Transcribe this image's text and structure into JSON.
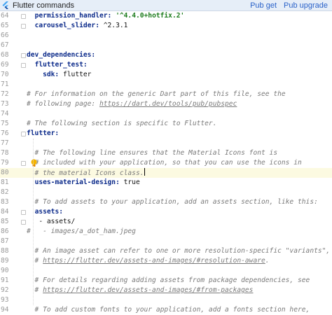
{
  "header": {
    "title": "Flutter commands",
    "actions": [
      "Pub get",
      "Pub upgrade"
    ]
  },
  "lines": [
    {
      "num": "64",
      "parts": [
        {
          "t": "  ",
          "c": "plain"
        },
        {
          "t": "permission_handler:",
          "c": "key"
        },
        {
          "t": " ",
          "c": "plain"
        },
        {
          "t": "'^4.4.0+hotfix.2'",
          "c": "str"
        }
      ]
    },
    {
      "num": "65",
      "parts": [
        {
          "t": "  ",
          "c": "plain"
        },
        {
          "t": "carousel_slider:",
          "c": "key"
        },
        {
          "t": " ^2.3.1",
          "c": "plain"
        }
      ]
    },
    {
      "num": "66",
      "parts": []
    },
    {
      "num": "67",
      "parts": []
    },
    {
      "num": "68",
      "parts": [
        {
          "t": "dev_dependencies:",
          "c": "key"
        }
      ]
    },
    {
      "num": "69",
      "parts": [
        {
          "t": "  ",
          "c": "plain"
        },
        {
          "t": "flutter_test:",
          "c": "key"
        }
      ]
    },
    {
      "num": "70",
      "parts": [
        {
          "t": "    ",
          "c": "plain"
        },
        {
          "t": "sdk:",
          "c": "key"
        },
        {
          "t": " flutter",
          "c": "plain"
        }
      ]
    },
    {
      "num": "71",
      "parts": []
    },
    {
      "num": "72",
      "parts": [
        {
          "t": "# For information on the generic Dart part of this file, see the",
          "c": "cmt"
        }
      ]
    },
    {
      "num": "73",
      "parts": [
        {
          "t": "# following page: ",
          "c": "cmt"
        },
        {
          "t": "https://dart.dev/tools/pub/pubspec",
          "c": "url"
        }
      ]
    },
    {
      "num": "74",
      "parts": []
    },
    {
      "num": "75",
      "parts": [
        {
          "t": "# The following section is specific to Flutter.",
          "c": "cmt"
        }
      ]
    },
    {
      "num": "76",
      "parts": [
        {
          "t": "flutter:",
          "c": "key"
        }
      ]
    },
    {
      "num": "77",
      "parts": []
    },
    {
      "num": "78",
      "parts": [
        {
          "t": "  # The following line ensures that the Material Icons font is",
          "c": "cmt"
        }
      ]
    },
    {
      "num": "79",
      "parts": [
        {
          "t": "  # included with your application, so that you can use the icons in",
          "c": "cmt"
        }
      ]
    },
    {
      "num": "80",
      "parts": [
        {
          "t": "  # the material Icons class.",
          "c": "cmt"
        }
      ],
      "current": true
    },
    {
      "num": "81",
      "parts": [
        {
          "t": "  ",
          "c": "plain"
        },
        {
          "t": "uses-material-design:",
          "c": "key"
        },
        {
          "t": " true",
          "c": "plain"
        }
      ]
    },
    {
      "num": "82",
      "parts": []
    },
    {
      "num": "83",
      "parts": [
        {
          "t": "  # To add assets to your application, add an assets section, like this:",
          "c": "cmt"
        }
      ]
    },
    {
      "num": "84",
      "parts": [
        {
          "t": "  ",
          "c": "plain"
        },
        {
          "t": "assets:",
          "c": "key"
        }
      ]
    },
    {
      "num": "85",
      "parts": [
        {
          "t": "   - assets/",
          "c": "plain"
        }
      ]
    },
    {
      "num": "86",
      "parts": [
        {
          "t": "#   - images/a_dot_ham.jpeg",
          "c": "cmt"
        }
      ]
    },
    {
      "num": "87",
      "parts": []
    },
    {
      "num": "88",
      "parts": [
        {
          "t": "  # An image asset can refer to one or more resolution-specific \"variants\", see",
          "c": "cmt"
        }
      ]
    },
    {
      "num": "89",
      "parts": [
        {
          "t": "  # ",
          "c": "cmt"
        },
        {
          "t": "https://flutter.dev/assets-and-images/#resolution-aware",
          "c": "url"
        },
        {
          "t": ".",
          "c": "cmt"
        }
      ]
    },
    {
      "num": "90",
      "parts": []
    },
    {
      "num": "91",
      "parts": [
        {
          "t": "  # For details regarding adding assets from package dependencies, see",
          "c": "cmt"
        }
      ]
    },
    {
      "num": "92",
      "parts": [
        {
          "t": "  # ",
          "c": "cmt"
        },
        {
          "t": "https://flutter.dev/assets-and-images/#from-packages",
          "c": "url"
        }
      ]
    },
    {
      "num": "93",
      "parts": []
    },
    {
      "num": "94",
      "parts": [
        {
          "t": "  # To add custom fonts to your application, add a fonts section here,",
          "c": "cmt"
        }
      ]
    }
  ]
}
